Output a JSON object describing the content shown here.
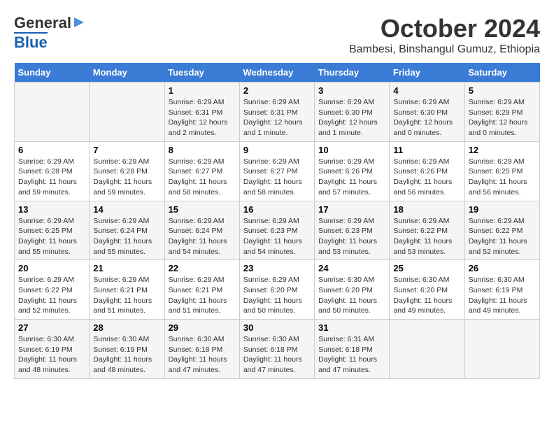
{
  "header": {
    "logo_general": "General",
    "logo_blue": "Blue",
    "month": "October 2024",
    "location": "Bambesi, Binshangul Gumuz, Ethiopia"
  },
  "days_of_week": [
    "Sunday",
    "Monday",
    "Tuesday",
    "Wednesday",
    "Thursday",
    "Friday",
    "Saturday"
  ],
  "weeks": [
    [
      {
        "day": "",
        "detail": ""
      },
      {
        "day": "",
        "detail": ""
      },
      {
        "day": "1",
        "detail": "Sunrise: 6:29 AM\nSunset: 6:31 PM\nDaylight: 12 hours\nand 2 minutes."
      },
      {
        "day": "2",
        "detail": "Sunrise: 6:29 AM\nSunset: 6:31 PM\nDaylight: 12 hours\nand 1 minute."
      },
      {
        "day": "3",
        "detail": "Sunrise: 6:29 AM\nSunset: 6:30 PM\nDaylight: 12 hours\nand 1 minute."
      },
      {
        "day": "4",
        "detail": "Sunrise: 6:29 AM\nSunset: 6:30 PM\nDaylight: 12 hours\nand 0 minutes."
      },
      {
        "day": "5",
        "detail": "Sunrise: 6:29 AM\nSunset: 6:29 PM\nDaylight: 12 hours\nand 0 minutes."
      }
    ],
    [
      {
        "day": "6",
        "detail": "Sunrise: 6:29 AM\nSunset: 6:28 PM\nDaylight: 11 hours\nand 59 minutes."
      },
      {
        "day": "7",
        "detail": "Sunrise: 6:29 AM\nSunset: 6:28 PM\nDaylight: 11 hours\nand 59 minutes."
      },
      {
        "day": "8",
        "detail": "Sunrise: 6:29 AM\nSunset: 6:27 PM\nDaylight: 11 hours\nand 58 minutes."
      },
      {
        "day": "9",
        "detail": "Sunrise: 6:29 AM\nSunset: 6:27 PM\nDaylight: 11 hours\nand 58 minutes."
      },
      {
        "day": "10",
        "detail": "Sunrise: 6:29 AM\nSunset: 6:26 PM\nDaylight: 11 hours\nand 57 minutes."
      },
      {
        "day": "11",
        "detail": "Sunrise: 6:29 AM\nSunset: 6:26 PM\nDaylight: 11 hours\nand 56 minutes."
      },
      {
        "day": "12",
        "detail": "Sunrise: 6:29 AM\nSunset: 6:25 PM\nDaylight: 11 hours\nand 56 minutes."
      }
    ],
    [
      {
        "day": "13",
        "detail": "Sunrise: 6:29 AM\nSunset: 6:25 PM\nDaylight: 11 hours\nand 55 minutes."
      },
      {
        "day": "14",
        "detail": "Sunrise: 6:29 AM\nSunset: 6:24 PM\nDaylight: 11 hours\nand 55 minutes."
      },
      {
        "day": "15",
        "detail": "Sunrise: 6:29 AM\nSunset: 6:24 PM\nDaylight: 11 hours\nand 54 minutes."
      },
      {
        "day": "16",
        "detail": "Sunrise: 6:29 AM\nSunset: 6:23 PM\nDaylight: 11 hours\nand 54 minutes."
      },
      {
        "day": "17",
        "detail": "Sunrise: 6:29 AM\nSunset: 6:23 PM\nDaylight: 11 hours\nand 53 minutes."
      },
      {
        "day": "18",
        "detail": "Sunrise: 6:29 AM\nSunset: 6:22 PM\nDaylight: 11 hours\nand 53 minutes."
      },
      {
        "day": "19",
        "detail": "Sunrise: 6:29 AM\nSunset: 6:22 PM\nDaylight: 11 hours\nand 52 minutes."
      }
    ],
    [
      {
        "day": "20",
        "detail": "Sunrise: 6:29 AM\nSunset: 6:22 PM\nDaylight: 11 hours\nand 52 minutes."
      },
      {
        "day": "21",
        "detail": "Sunrise: 6:29 AM\nSunset: 6:21 PM\nDaylight: 11 hours\nand 51 minutes."
      },
      {
        "day": "22",
        "detail": "Sunrise: 6:29 AM\nSunset: 6:21 PM\nDaylight: 11 hours\nand 51 minutes."
      },
      {
        "day": "23",
        "detail": "Sunrise: 6:29 AM\nSunset: 6:20 PM\nDaylight: 11 hours\nand 50 minutes."
      },
      {
        "day": "24",
        "detail": "Sunrise: 6:30 AM\nSunset: 6:20 PM\nDaylight: 11 hours\nand 50 minutes."
      },
      {
        "day": "25",
        "detail": "Sunrise: 6:30 AM\nSunset: 6:20 PM\nDaylight: 11 hours\nand 49 minutes."
      },
      {
        "day": "26",
        "detail": "Sunrise: 6:30 AM\nSunset: 6:19 PM\nDaylight: 11 hours\nand 49 minutes."
      }
    ],
    [
      {
        "day": "27",
        "detail": "Sunrise: 6:30 AM\nSunset: 6:19 PM\nDaylight: 11 hours\nand 48 minutes."
      },
      {
        "day": "28",
        "detail": "Sunrise: 6:30 AM\nSunset: 6:19 PM\nDaylight: 11 hours\nand 48 minutes."
      },
      {
        "day": "29",
        "detail": "Sunrise: 6:30 AM\nSunset: 6:18 PM\nDaylight: 11 hours\nand 47 minutes."
      },
      {
        "day": "30",
        "detail": "Sunrise: 6:30 AM\nSunset: 6:18 PM\nDaylight: 11 hours\nand 47 minutes."
      },
      {
        "day": "31",
        "detail": "Sunrise: 6:31 AM\nSunset: 6:18 PM\nDaylight: 11 hours\nand 47 minutes."
      },
      {
        "day": "",
        "detail": ""
      },
      {
        "day": "",
        "detail": ""
      }
    ]
  ]
}
